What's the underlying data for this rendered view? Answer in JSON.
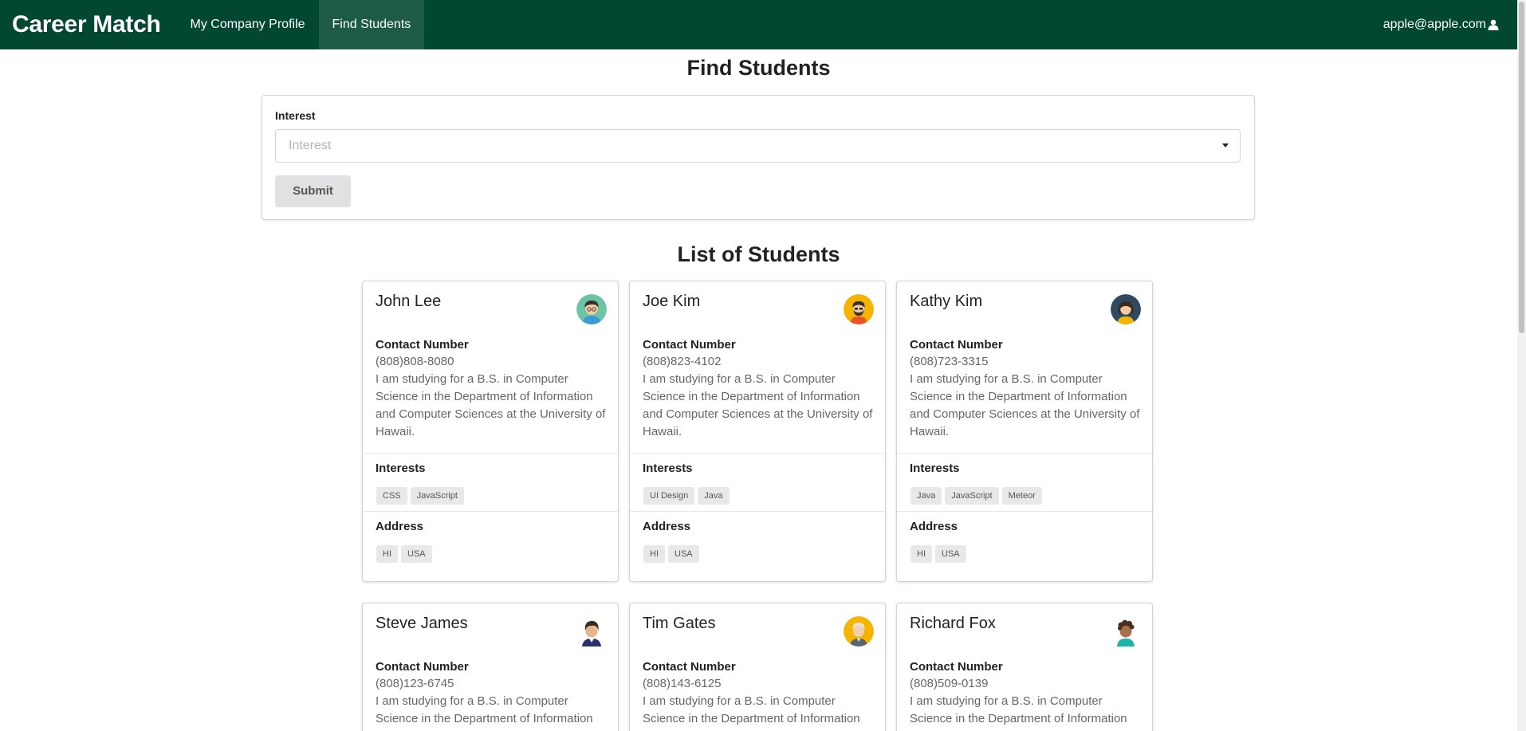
{
  "nav": {
    "brand": "Career Match",
    "items": [
      {
        "label": "My Company Profile"
      },
      {
        "label": "Find Students"
      }
    ],
    "user_email": "apple@apple.com",
    "bg_color": "#024731"
  },
  "find": {
    "heading": "Find Students",
    "interest_label": "Interest",
    "interest_placeholder": "Interest",
    "submit_label": "Submit"
  },
  "list": {
    "heading": "List of Students",
    "contact_label": "Contact Number",
    "interests_label": "Interests",
    "address_label": "Address"
  },
  "students": [
    {
      "name": "John Lee",
      "avatar_icon": "boy-avatar-icon",
      "phone": "(808)808-8080",
      "description": "I am studying for a B.S. in Computer Science in the Department of Information and Computer Sciences at the University of Hawaii.",
      "interests": [
        "CSS",
        "JavaScript"
      ],
      "address": [
        "HI",
        "USA"
      ]
    },
    {
      "name": "Joe Kim",
      "avatar_icon": "bearded-man-avatar-icon",
      "phone": "(808)823-4102",
      "description": "I am studying for a B.S. in Computer Science in the Department of Information and Computer Sciences at the University of Hawaii.",
      "interests": [
        "UI Design",
        "Java"
      ],
      "address": [
        "HI",
        "USA"
      ]
    },
    {
      "name": "Kathy Kim",
      "avatar_icon": "woman-avatar-icon",
      "phone": "(808)723-3315",
      "description": "I am studying for a B.S. in Computer Science in the Department of Information and Computer Sciences at the University of Hawaii.",
      "interests": [
        "Java",
        "JavaScript",
        "Meteor"
      ],
      "address": [
        "HI",
        "USA"
      ]
    },
    {
      "name": "Steve James",
      "avatar_icon": "man-suit-avatar-icon",
      "phone": "(808)123-6745",
      "description": "I am studying for a B.S. in Computer Science in the Department of Information and Computer Sciences at the University of Hawaii.",
      "interests": [],
      "address": []
    },
    {
      "name": "Tim Gates",
      "avatar_icon": "man-avatar-icon",
      "phone": "(808)143-6125",
      "description": "I am studying for a B.S. in Computer Science in the Department of Information and Computer Sciences at the University of Hawaii.",
      "interests": [],
      "address": []
    },
    {
      "name": "Richard Fox",
      "avatar_icon": "curly-hair-man-avatar-icon",
      "phone": "(808)509-0139",
      "description": "I am studying for a B.S. in Computer Science in the Department of Information and Computer Sciences at the University of Hawaii.",
      "interests": [],
      "address": []
    }
  ]
}
